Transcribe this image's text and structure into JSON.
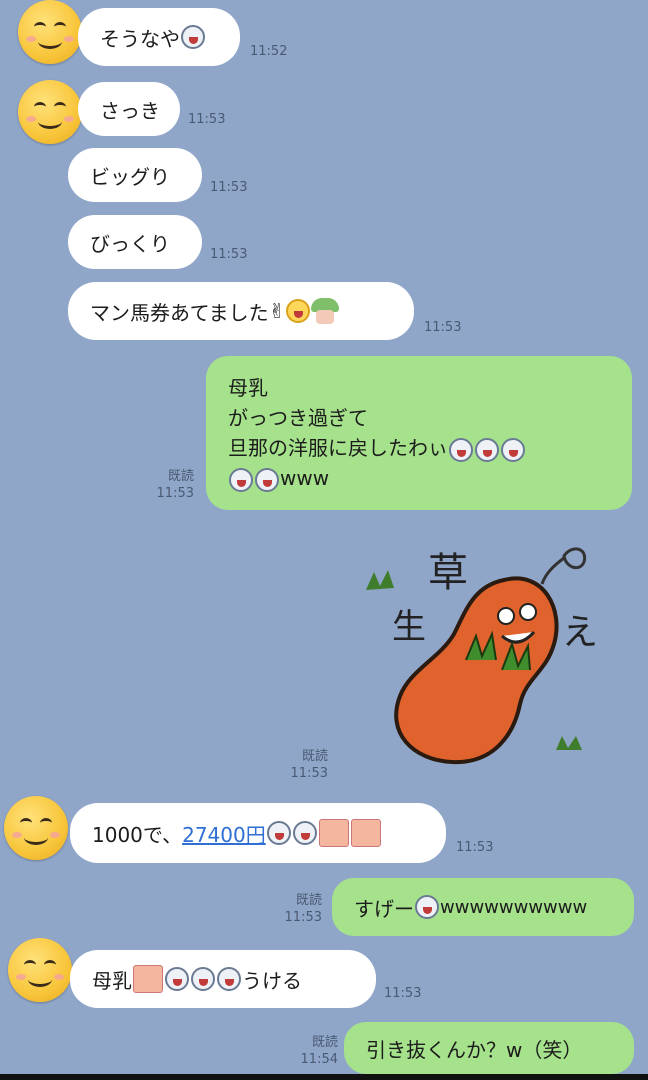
{
  "messages": [
    {
      "text": "そうなや",
      "time": "11:52"
    },
    {
      "text": "さっき",
      "time": "11:53"
    },
    {
      "text": "ビッグり",
      "time": "11:53"
    },
    {
      "text": "びっくり",
      "time": "11:53"
    },
    {
      "text": "マン馬券あてました",
      "time": "11:53"
    },
    {
      "lines": [
        "母乳",
        "がっつき過ぎて",
        "旦那の洋服に戻したわぃ",
        "www"
      ],
      "read": "既読",
      "time": "11:53"
    },
    {
      "read": "既読",
      "time": "11:53",
      "sticker_text": [
        "草",
        "生",
        "え"
      ]
    },
    {
      "text_pre": "1000で、",
      "link": "27400円",
      "time": "11:53"
    },
    {
      "text_pre": "すげー",
      "text_post": "wwwwwwwwww",
      "read": "既読",
      "time": "11:53"
    },
    {
      "text_pre": "母乳",
      "text_post": "うける",
      "time": "11:53"
    },
    {
      "text": "引き抜くんか？w（笑）",
      "read": "既読",
      "time": "11:54"
    }
  ],
  "colors": {
    "background": "#8fa6c9",
    "incoming": "#ffffff",
    "outgoing": "#a6e28b",
    "link": "#2f6fd3"
  },
  "icons": {
    "avatar": "smiley-face-icon",
    "emoji": "laughing-face-emoji-icon",
    "victory": "victory-hand-icon"
  }
}
